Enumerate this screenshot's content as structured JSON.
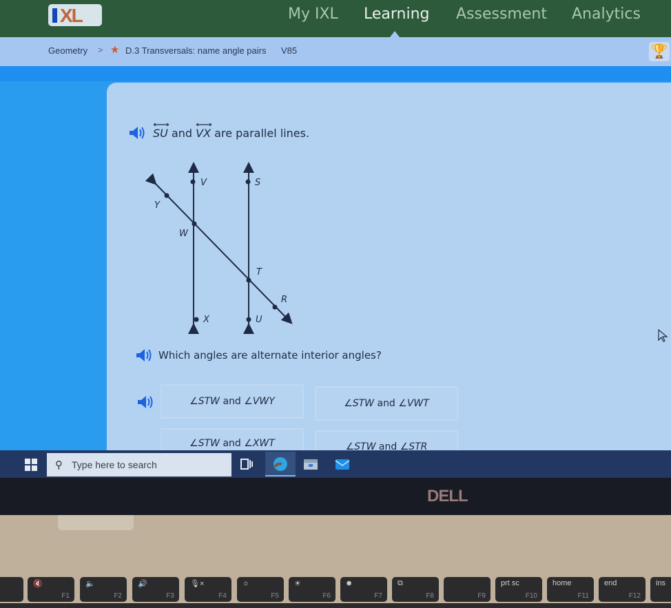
{
  "nav": {
    "logo": "IXL",
    "items": [
      {
        "label": "My IXL",
        "active": false
      },
      {
        "label": "Learning",
        "active": true
      },
      {
        "label": "Assessment",
        "active": false
      },
      {
        "label": "Analytics",
        "active": false
      }
    ]
  },
  "breadcrumb": {
    "subject": "Geometry",
    "separator": ">",
    "skill": "D.3 Transversals: name angle pairs",
    "skill_code": "V85"
  },
  "problem": {
    "statement": {
      "line1": "SU",
      "conjunction": "and",
      "line2": "VX",
      "rest": "are parallel lines."
    },
    "figure": {
      "points": [
        "V",
        "S",
        "Y",
        "W",
        "T",
        "R",
        "X",
        "U"
      ],
      "parallel_lines": [
        "VX",
        "SU"
      ],
      "transversal": "YR"
    },
    "question": "Which angles are alternate interior angles?",
    "choices": [
      {
        "a": "∠STW",
        "and": "and",
        "b": "∠VWY"
      },
      {
        "a": "∠STW",
        "and": "and",
        "b": "∠VWT"
      },
      {
        "a": "∠STW",
        "and": "and",
        "b": "∠XWT"
      },
      {
        "a": "∠STW",
        "and": "and",
        "b": "∠STR"
      }
    ]
  },
  "taskbar": {
    "search_placeholder": "Type here to search",
    "apps": [
      "task-view",
      "edge",
      "file-explorer",
      "mail"
    ]
  },
  "hardware": {
    "brand": "DELL",
    "fkeys": [
      {
        "top": "🔇",
        "fn": "F1"
      },
      {
        "top": "🔈",
        "fn": "F2"
      },
      {
        "top": "🔊",
        "fn": "F3"
      },
      {
        "top": "🎙×",
        "fn": "F4"
      },
      {
        "top": "☼",
        "fn": "F5"
      },
      {
        "top": "☀",
        "fn": "F6"
      },
      {
        "top": "✹",
        "fn": "F7"
      },
      {
        "top": "⧉",
        "fn": "F8"
      },
      {
        "top": "",
        "fn": "F9"
      },
      {
        "top": "prt sc",
        "fn": "F10"
      },
      {
        "top": "home",
        "fn": "F11"
      },
      {
        "top": "end",
        "fn": "F12"
      },
      {
        "top": "ins",
        "fn": ""
      }
    ]
  }
}
